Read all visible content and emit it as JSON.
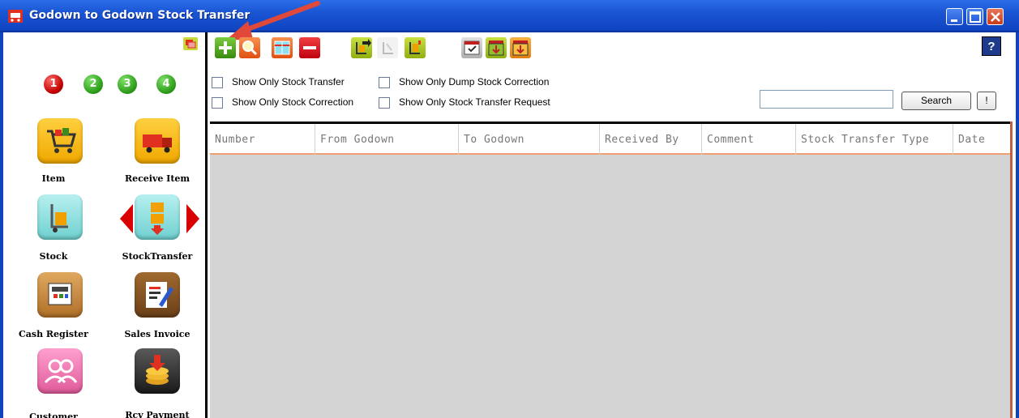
{
  "window": {
    "title": "Godown to Godown Stock Transfer",
    "accent": "#1a55d4"
  },
  "sidebar": {
    "steps": [
      "1",
      "2",
      "3",
      "4"
    ],
    "items": [
      {
        "label": "Item",
        "icon": "shopping-cart-icon",
        "color": "#f5b400"
      },
      {
        "label": "Receive Item",
        "icon": "delivery-truck-icon",
        "color": "#f5b400"
      },
      {
        "label": "Stock",
        "icon": "hand-truck-icon",
        "color": "#8ee0e0"
      },
      {
        "label": "StockTransfer",
        "icon": "stock-transfer-icon",
        "color": "#8ee0e0"
      },
      {
        "label": "Cash Register",
        "icon": "cash-register-icon",
        "color": "#c8893a"
      },
      {
        "label": "Sales Invoice",
        "icon": "invoice-pen-icon",
        "color": "#8a5a2a"
      },
      {
        "label": "Customer",
        "icon": "customers-icon",
        "color": "#f07ab0"
      },
      {
        "label": "Rcv Payment",
        "icon": "receive-payment-icon",
        "color": "#3a3a3a"
      }
    ]
  },
  "toolbar": {
    "buttons": [
      "add",
      "search-record",
      "edit-table",
      "delete",
      "transfer-out",
      "transfer-disabled",
      "transfer-in",
      "calendar-check",
      "table-down",
      "table-export"
    ],
    "help_label": "?"
  },
  "filters": {
    "show_stock_transfer": "Show Only Stock Transfer",
    "show_dump_correction": "Show Only Dump Stock Correction",
    "show_stock_correction": "Show Only Stock Correction",
    "show_transfer_request": "Show Only Stock Transfer Request"
  },
  "search": {
    "value": "",
    "button_label": "Search",
    "extra_label": "!"
  },
  "grid": {
    "columns": [
      "Number",
      "From Godown",
      "To Godown",
      "Received By",
      "Comment",
      "Stock Transfer Type",
      "Date"
    ],
    "rows": []
  }
}
